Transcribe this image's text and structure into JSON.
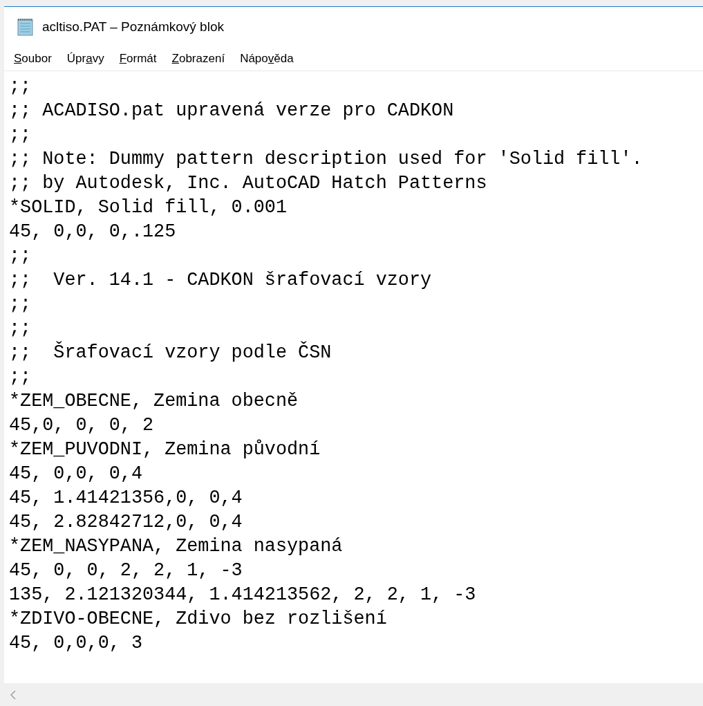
{
  "window": {
    "title": "acltiso.PAT – Poznámkový blok"
  },
  "menu": [
    {
      "accelerator": "S",
      "rest": "oubor"
    },
    {
      "before": "Úpr",
      "accelerator": "a",
      "rest": "vy"
    },
    {
      "accelerator": "F",
      "rest": "ormát"
    },
    {
      "accelerator": "Z",
      "rest": "obrazení"
    },
    {
      "before": "Nápo",
      "accelerator": "v",
      "rest": "ěda"
    }
  ],
  "editor": {
    "lines": [
      ";;",
      ";; ACADISO.pat upravená verze pro CADKON",
      ";;",
      ";; Note: Dummy pattern description used for 'Solid fill'.",
      ";; by Autodesk, Inc. AutoCAD Hatch Patterns",
      "*SOLID, Solid fill, 0.001",
      "45, 0,0, 0,.125",
      ";;",
      ";;  Ver. 14.1 - CADKON šrafovací vzory",
      ";;",
      ";;",
      ";;  Šrafovací vzory podle ČSN",
      ";;",
      "*ZEM_OBECNE, Zemina obecně",
      "45,0, 0, 0, 2",
      "*ZEM_PUVODNI, Zemina původní",
      "45, 0,0, 0,4",
      "45, 1.41421356,0, 0,4",
      "45, 2.82842712,0, 0,4",
      "*ZEM_NASYPANA, Zemina nasypaná",
      "45, 0, 0, 2, 2, 1, -3",
      "135, 2.121320344, 1.414213562, 2, 2, 1, -3",
      "*ZDIVO-OBECNE, Zdivo bez rozlišení",
      "45, 0,0,0, 3"
    ]
  }
}
